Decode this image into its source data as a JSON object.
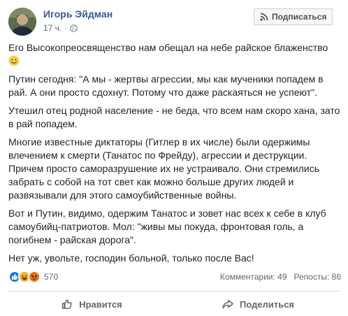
{
  "post": {
    "author": "Игорь Эйдман",
    "time": "17 ч.",
    "subscribe_label": "Подписаться",
    "paragraphs": [
      "Его Высокопреосвященство нам обещал на небе райское блаженство",
      "Путин сегодня: \"А мы - жертвы агрессии, мы как мученики попадем в рай. А они просто сдохнут. Потому что даже раскаяться не успеют\".",
      "Утешил отец родной население - не беда, что всем нам скоро хана, зато в рай попадем.",
      "Многие известные диктаторы (Гитлер в их числе) были одержимы влечением к смерти (Танатос по Фрейду), агрессии и деструкции. Причем просто саморазрушение их не устраивало. Они стремились забрать с собой на тот свет как можно больше других людей и развязывали для этого самоубийственные войны.",
      "Вот и Путин, видимо, одержим Танатос и зовет нас всех к себе в клуб самоубийц-патриотов. Мол: \"живы мы покуда, фронтовая голь, а погибнем - райская дорога\".",
      "Нет уж, увольте, господин больной, только после Вас!"
    ]
  },
  "stats": {
    "reactions_count": "570",
    "comments": "Комментарии: 49",
    "shares": "Репосты: 86",
    "reaction_icons": [
      "like-icon",
      "haha-icon",
      "angry-icon"
    ]
  },
  "actions": {
    "like_label": "Нравится",
    "share_label": "Поделиться"
  },
  "colors": {
    "link": "#385898",
    "like": "#1877f2",
    "haha": "#f7b125",
    "angry": "#e9710f"
  }
}
